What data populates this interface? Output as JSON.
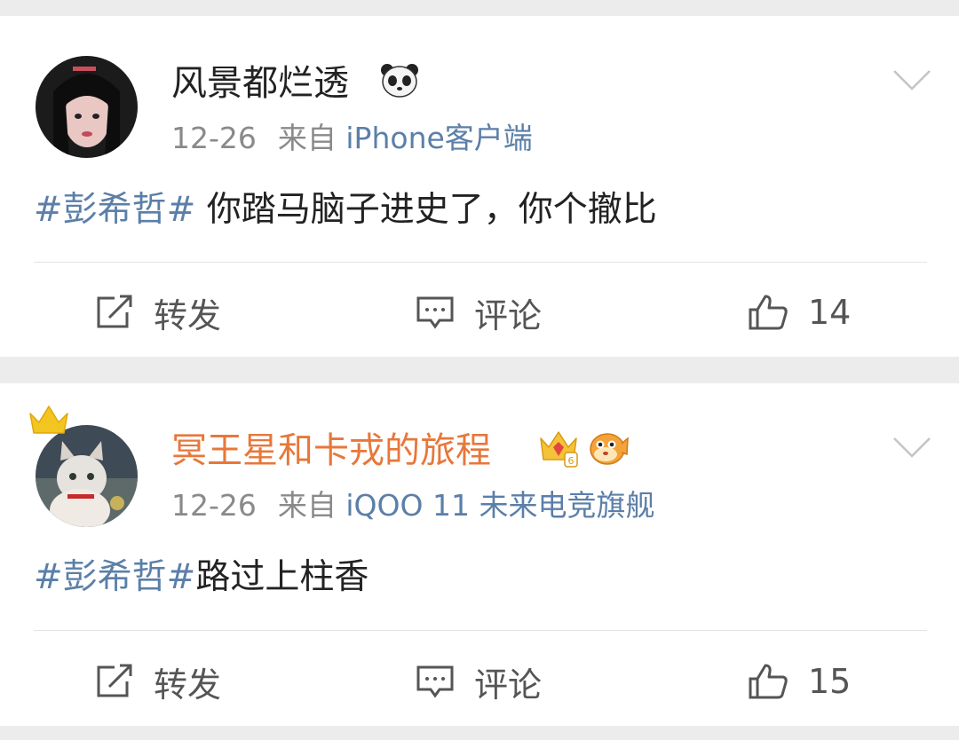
{
  "posts": [
    {
      "username": "风景都烂透",
      "username_color": "#222222",
      "date": "12-26",
      "from_label": "来自",
      "source": "iPhone客户端",
      "tag": "#彭希哲#",
      "text": " 你踏马脑子进史了，你个撤比",
      "repost_label": "转发",
      "comment_label": "评论",
      "like_count": "14",
      "badges": [
        "panda-icon"
      ]
    },
    {
      "username": "冥王星和卡戎的旅程",
      "username_color": "#e8773a",
      "date": "12-26",
      "from_label": "来自",
      "source": "iQOO 11 未来电竞旗舰",
      "tag": "#彭希哲#",
      "text": "路过上柱香",
      "repost_label": "转发",
      "comment_label": "评论",
      "like_count": "15",
      "badges": [
        "vip-crown-badge-icon",
        "pufferfish-icon"
      ]
    }
  ],
  "colors": {
    "link": "#5b7fa8",
    "meta": "#8a8a8a",
    "text": "#222222",
    "background": "#ececec",
    "vip_name": "#e8773a"
  }
}
